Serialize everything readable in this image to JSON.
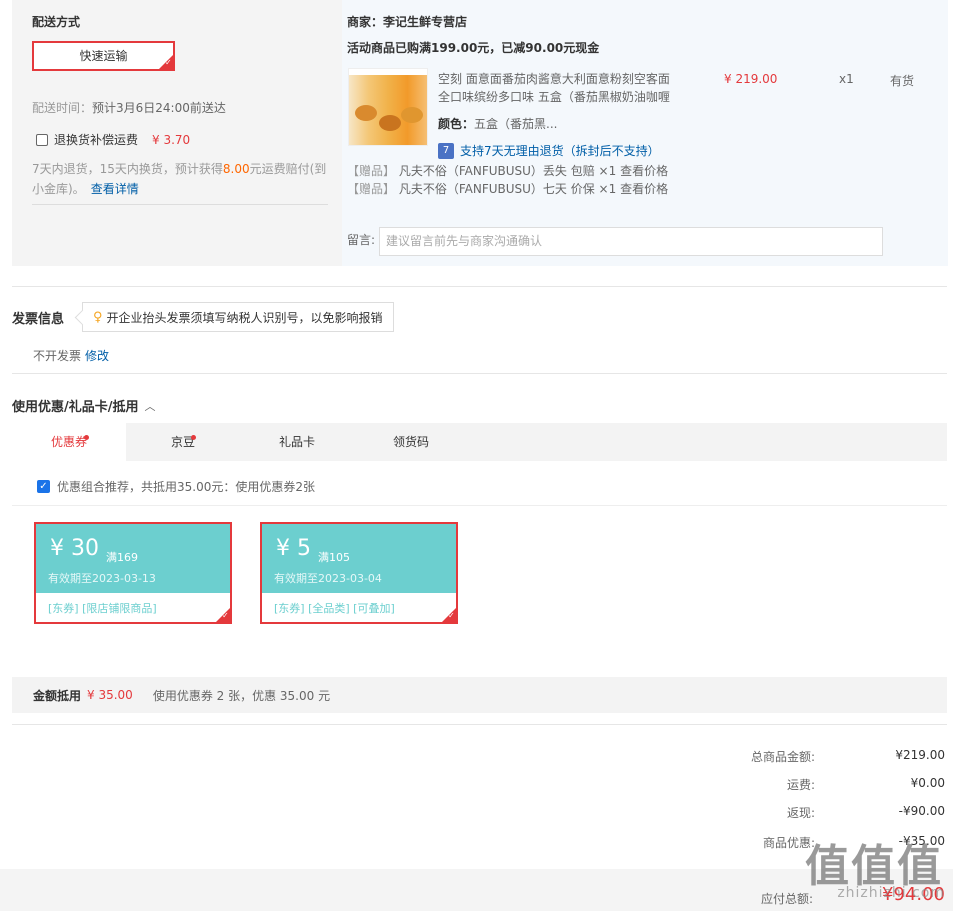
{
  "shipping": {
    "title": "配送方式",
    "method": "快速运输",
    "time_label": "配送时间：",
    "time_value": "预计3月6日24:00前送达",
    "refund_label": "退换货补偿运费",
    "refund_price": "¥ 3.70",
    "refund_desc_1": "7天内退货，15天内换货，预计获得",
    "refund_amount": "8.00",
    "refund_desc_2": "元运费赔付(到小金库)。",
    "refund_link": "查看详情"
  },
  "merchant": {
    "name": "商家：李记生鲜专营店",
    "promo": "活动商品已购满199.00元，已减90.00元现金"
  },
  "product": {
    "name": "空刻 面意面番茄肉酱意大利面意粉刻空客面全口味缤纷多口味 五盒（番茄黑椒奶油咖喱",
    "price": "¥ 219.00",
    "qty": "x1",
    "stock": "有货",
    "color_label": "颜色：",
    "color_value": "五盒（番茄黑...",
    "return_badge": "7",
    "return_text": "支持7天无理由退货（拆封后不支持）"
  },
  "gifts": [
    {
      "tag": "【赠品】",
      "text": "凡夫不俗（FANFUBUSU）丢失 包赔 ×1",
      "link": "查看价格"
    },
    {
      "tag": "【赠品】",
      "text": "凡夫不俗（FANFUBUSU）七天 价保 ×1",
      "link": "查看价格"
    }
  ],
  "message": {
    "label": "留言:",
    "placeholder": "建议留言前先与商家沟通确认"
  },
  "invoice": {
    "title": "发票信息",
    "tip": "开企业抬头发票须填写纳税人识别号，以免影响报销",
    "status": "不开发票",
    "edit_link": "修改"
  },
  "discount": {
    "title": "使用优惠/礼品卡/抵用",
    "tabs": [
      "优惠券",
      "京豆",
      "礼品卡",
      "领货码"
    ],
    "recommend": "优惠组合推荐，共抵用35.00元：使用优惠券2张",
    "coupons": [
      {
        "amount": "¥ 30",
        "condition": "满169",
        "expiry": "有效期至2023-03-13",
        "tags": "[东券] [限店铺限商品]"
      },
      {
        "amount": "¥ 5",
        "condition": "满105",
        "expiry": "有效期至2023-03-04",
        "tags": "[东券] [全品类] [可叠加]"
      }
    ],
    "summary_label": "金额抵用",
    "summary_value": "¥ 35.00",
    "summary_desc": "使用优惠券 2 张，优惠 35.00 元"
  },
  "totals": {
    "rows": [
      {
        "label": "总商品金额:",
        "value": "¥219.00"
      },
      {
        "label": "运费:",
        "value": "¥0.00"
      },
      {
        "label": "返现:",
        "value": "-¥90.00"
      },
      {
        "label": "商品优惠:",
        "value": "-¥35.00"
      }
    ],
    "pay_label": "应付总额:",
    "pay_value": "¥94.00"
  },
  "watermark": {
    "text": "zhizhizhi.com",
    "logo": "值值值"
  },
  "colors": {
    "accent": "#e4393c",
    "coupon": "#6ccfcf",
    "link": "#005ea7"
  }
}
